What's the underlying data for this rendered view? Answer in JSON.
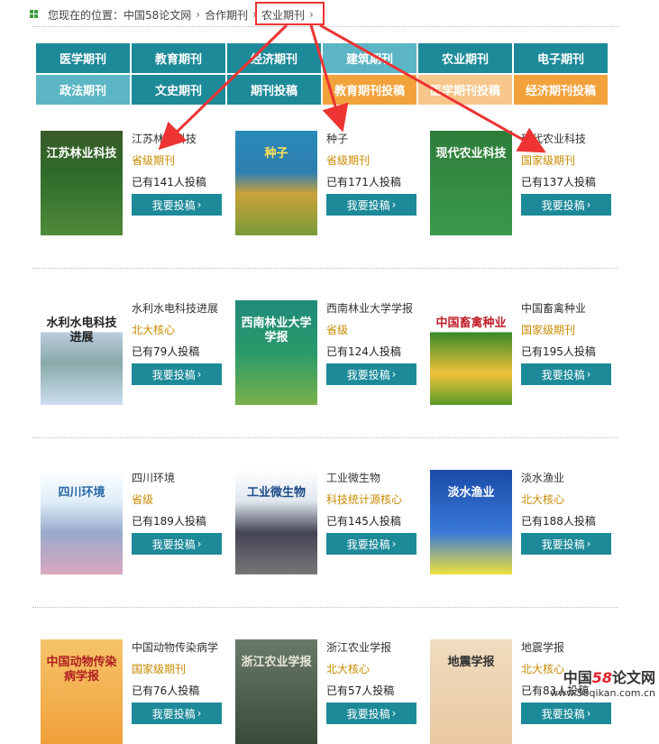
{
  "breadcrumb": {
    "label": "您现在的位置：",
    "items": [
      "中国58论文网",
      "合作期刊",
      "农业期刊"
    ]
  },
  "nav": {
    "row1": [
      "医学期刊",
      "教育期刊",
      "经济期刊",
      "建筑期刊",
      "农业期刊",
      "电子期刊"
    ],
    "row2": [
      "政法期刊",
      "文史期刊",
      "期刊投稿",
      "教育期刊投稿",
      "医学期刊投稿",
      "经济期刊投稿"
    ]
  },
  "button_label": "我要投稿",
  "journals": [
    {
      "name": "江苏林业科技",
      "level": "省级期刊",
      "count": "已有141人投稿",
      "cover_title": "江苏林业科技"
    },
    {
      "name": "种子",
      "level": "省级期刊",
      "count": "已有171人投稿",
      "cover_title": "种子"
    },
    {
      "name": "现代农业科技",
      "level": "国家级期刊",
      "count": "已有137人投稿",
      "cover_title": "现代农业科技"
    },
    {
      "name": "水利水电科技进展",
      "level": "北大核心",
      "count": "已有79人投稿",
      "cover_title": "水利水电科技进展"
    },
    {
      "name": "西南林业大学学报",
      "level": "省级",
      "count": "已有124人投稿",
      "cover_title": "西南林业大学学报"
    },
    {
      "name": "中国畜禽种业",
      "level": "国家级期刊",
      "count": "已有195人投稿",
      "cover_title": "中国畜禽种业"
    },
    {
      "name": "四川环境",
      "level": "省级",
      "count": "已有189人投稿",
      "cover_title": "四川环境"
    },
    {
      "name": "工业微生物",
      "level": "科技统计源核心",
      "count": "已有145人投稿",
      "cover_title": "工业微生物"
    },
    {
      "name": "淡水渔业",
      "level": "北大核心",
      "count": "已有188人投稿",
      "cover_title": "淡水渔业"
    },
    {
      "name": "中国动物传染病学",
      "level": "国家级期刊",
      "count": "已有76人投稿",
      "cover_title": "中国动物传染病学报"
    },
    {
      "name": "浙江农业学报",
      "level": "北大核心",
      "count": "已有57人投稿",
      "cover_title": "浙江农业学报"
    },
    {
      "name": "地震学报",
      "level": "北大核心",
      "count": "已有83人投稿",
      "cover_title": "地震学报"
    }
  ],
  "watermark": {
    "name_a": "中国",
    "name_num": "58",
    "name_b": "论文网",
    "url": "www.58qikan.com.cn"
  },
  "colors": {
    "teal": "#1d8a99",
    "light_teal": "#5bb5c5",
    "orange": "#f2a23a",
    "level": "#c98a00",
    "arrow": "#e33"
  }
}
